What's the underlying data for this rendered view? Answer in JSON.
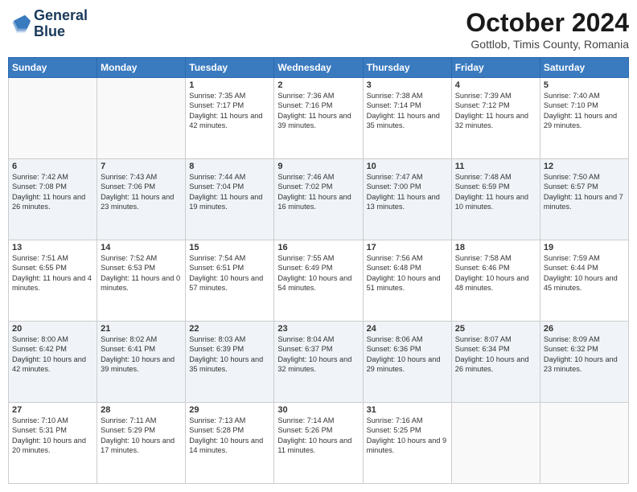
{
  "header": {
    "logo_line1": "General",
    "logo_line2": "Blue",
    "title": "October 2024",
    "subtitle": "Gottlob, Timis County, Romania"
  },
  "days_of_week": [
    "Sunday",
    "Monday",
    "Tuesday",
    "Wednesday",
    "Thursday",
    "Friday",
    "Saturday"
  ],
  "weeks": [
    [
      {
        "num": "",
        "info": ""
      },
      {
        "num": "",
        "info": ""
      },
      {
        "num": "1",
        "info": "Sunrise: 7:35 AM\nSunset: 7:17 PM\nDaylight: 11 hours and 42 minutes."
      },
      {
        "num": "2",
        "info": "Sunrise: 7:36 AM\nSunset: 7:16 PM\nDaylight: 11 hours and 39 minutes."
      },
      {
        "num": "3",
        "info": "Sunrise: 7:38 AM\nSunset: 7:14 PM\nDaylight: 11 hours and 35 minutes."
      },
      {
        "num": "4",
        "info": "Sunrise: 7:39 AM\nSunset: 7:12 PM\nDaylight: 11 hours and 32 minutes."
      },
      {
        "num": "5",
        "info": "Sunrise: 7:40 AM\nSunset: 7:10 PM\nDaylight: 11 hours and 29 minutes."
      }
    ],
    [
      {
        "num": "6",
        "info": "Sunrise: 7:42 AM\nSunset: 7:08 PM\nDaylight: 11 hours and 26 minutes."
      },
      {
        "num": "7",
        "info": "Sunrise: 7:43 AM\nSunset: 7:06 PM\nDaylight: 11 hours and 23 minutes."
      },
      {
        "num": "8",
        "info": "Sunrise: 7:44 AM\nSunset: 7:04 PM\nDaylight: 11 hours and 19 minutes."
      },
      {
        "num": "9",
        "info": "Sunrise: 7:46 AM\nSunset: 7:02 PM\nDaylight: 11 hours and 16 minutes."
      },
      {
        "num": "10",
        "info": "Sunrise: 7:47 AM\nSunset: 7:00 PM\nDaylight: 11 hours and 13 minutes."
      },
      {
        "num": "11",
        "info": "Sunrise: 7:48 AM\nSunset: 6:59 PM\nDaylight: 11 hours and 10 minutes."
      },
      {
        "num": "12",
        "info": "Sunrise: 7:50 AM\nSunset: 6:57 PM\nDaylight: 11 hours and 7 minutes."
      }
    ],
    [
      {
        "num": "13",
        "info": "Sunrise: 7:51 AM\nSunset: 6:55 PM\nDaylight: 11 hours and 4 minutes."
      },
      {
        "num": "14",
        "info": "Sunrise: 7:52 AM\nSunset: 6:53 PM\nDaylight: 11 hours and 0 minutes."
      },
      {
        "num": "15",
        "info": "Sunrise: 7:54 AM\nSunset: 6:51 PM\nDaylight: 10 hours and 57 minutes."
      },
      {
        "num": "16",
        "info": "Sunrise: 7:55 AM\nSunset: 6:49 PM\nDaylight: 10 hours and 54 minutes."
      },
      {
        "num": "17",
        "info": "Sunrise: 7:56 AM\nSunset: 6:48 PM\nDaylight: 10 hours and 51 minutes."
      },
      {
        "num": "18",
        "info": "Sunrise: 7:58 AM\nSunset: 6:46 PM\nDaylight: 10 hours and 48 minutes."
      },
      {
        "num": "19",
        "info": "Sunrise: 7:59 AM\nSunset: 6:44 PM\nDaylight: 10 hours and 45 minutes."
      }
    ],
    [
      {
        "num": "20",
        "info": "Sunrise: 8:00 AM\nSunset: 6:42 PM\nDaylight: 10 hours and 42 minutes."
      },
      {
        "num": "21",
        "info": "Sunrise: 8:02 AM\nSunset: 6:41 PM\nDaylight: 10 hours and 39 minutes."
      },
      {
        "num": "22",
        "info": "Sunrise: 8:03 AM\nSunset: 6:39 PM\nDaylight: 10 hours and 35 minutes."
      },
      {
        "num": "23",
        "info": "Sunrise: 8:04 AM\nSunset: 6:37 PM\nDaylight: 10 hours and 32 minutes."
      },
      {
        "num": "24",
        "info": "Sunrise: 8:06 AM\nSunset: 6:36 PM\nDaylight: 10 hours and 29 minutes."
      },
      {
        "num": "25",
        "info": "Sunrise: 8:07 AM\nSunset: 6:34 PM\nDaylight: 10 hours and 26 minutes."
      },
      {
        "num": "26",
        "info": "Sunrise: 8:09 AM\nSunset: 6:32 PM\nDaylight: 10 hours and 23 minutes."
      }
    ],
    [
      {
        "num": "27",
        "info": "Sunrise: 7:10 AM\nSunset: 5:31 PM\nDaylight: 10 hours and 20 minutes."
      },
      {
        "num": "28",
        "info": "Sunrise: 7:11 AM\nSunset: 5:29 PM\nDaylight: 10 hours and 17 minutes."
      },
      {
        "num": "29",
        "info": "Sunrise: 7:13 AM\nSunset: 5:28 PM\nDaylight: 10 hours and 14 minutes."
      },
      {
        "num": "30",
        "info": "Sunrise: 7:14 AM\nSunset: 5:26 PM\nDaylight: 10 hours and 11 minutes."
      },
      {
        "num": "31",
        "info": "Sunrise: 7:16 AM\nSunset: 5:25 PM\nDaylight: 10 hours and 9 minutes."
      },
      {
        "num": "",
        "info": ""
      },
      {
        "num": "",
        "info": ""
      }
    ]
  ]
}
